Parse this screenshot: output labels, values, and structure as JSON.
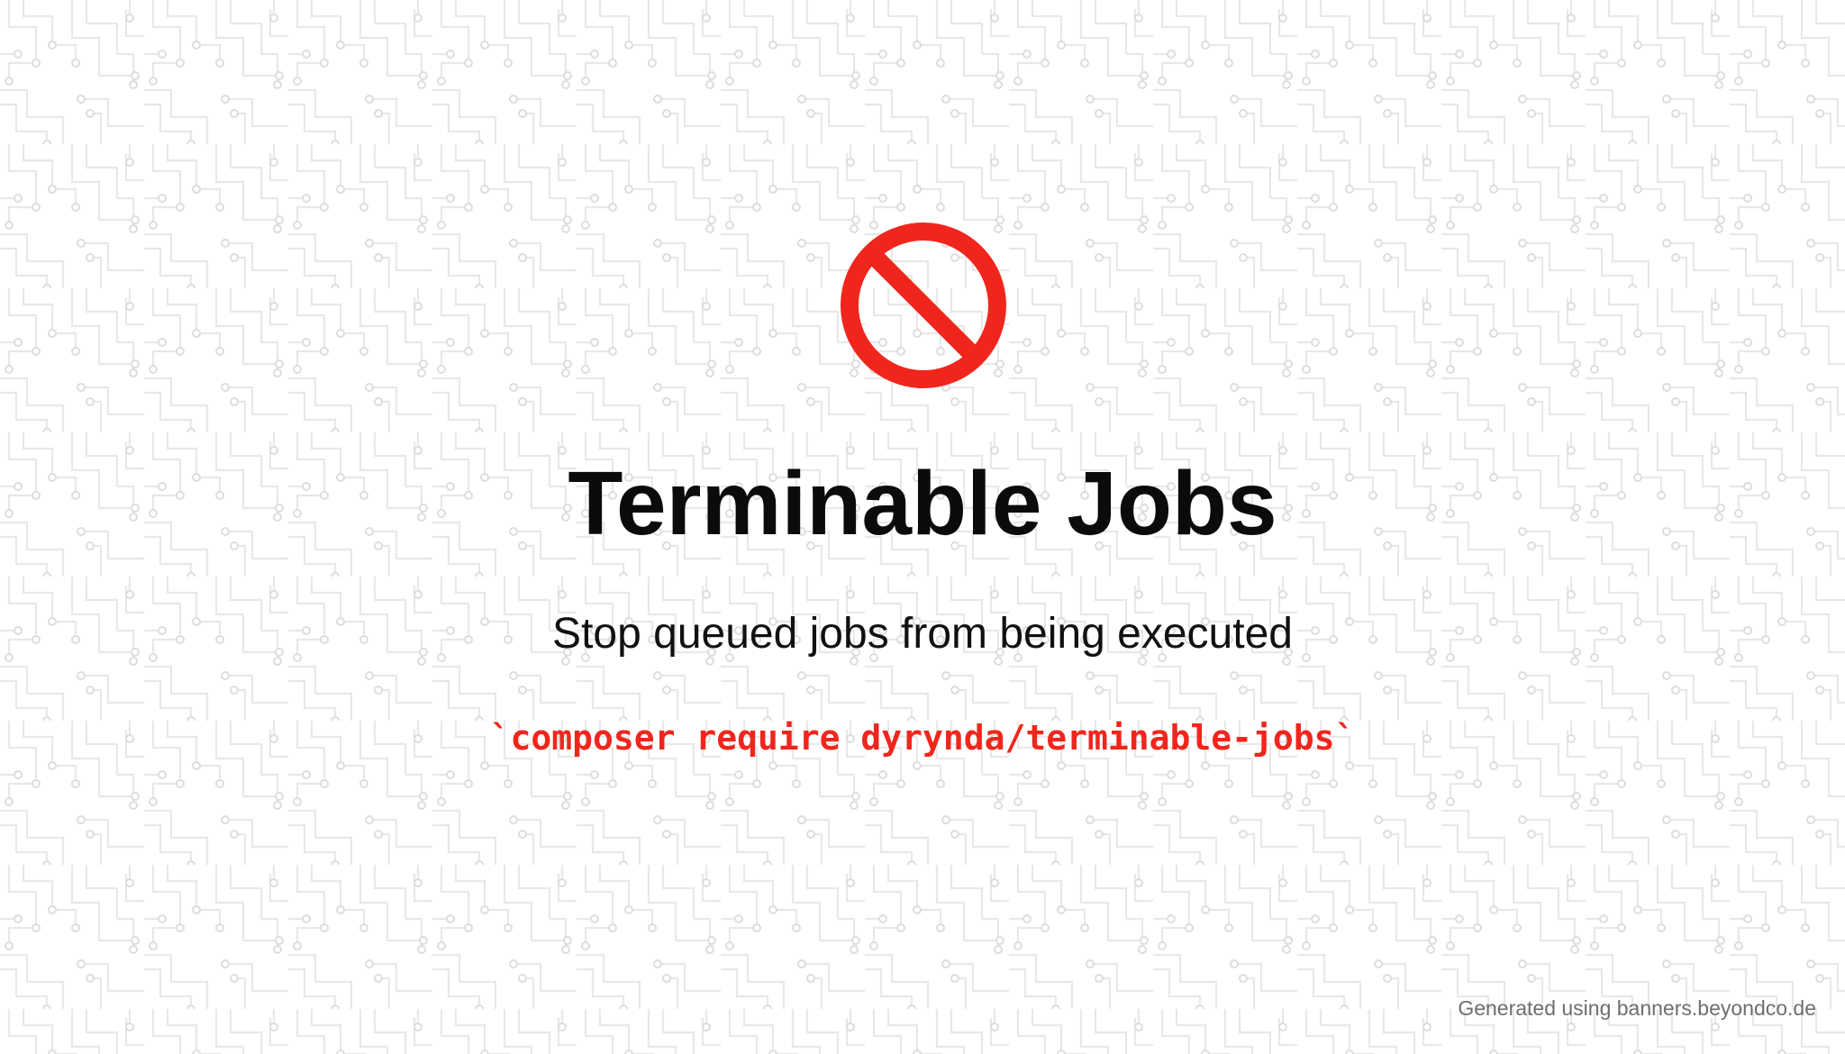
{
  "banner": {
    "icon": "prohibited-icon",
    "title": "Terminable Jobs",
    "subtitle": "Stop queued jobs from being executed",
    "install_command": "`composer require dyrynda/terminable-jobs`",
    "footer_credit": "Generated using banners.beyondco.de"
  },
  "colors": {
    "background": "#ffffff",
    "pattern": "#e6e6e6",
    "title": "#0b0b0b",
    "accent": "#f0261d",
    "footer": "#6e6e6e"
  }
}
